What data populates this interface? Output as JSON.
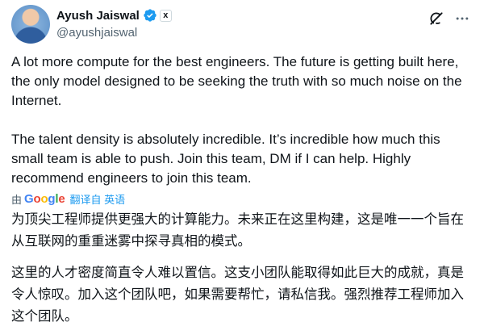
{
  "author": {
    "display_name": "Ayush Jaiswal",
    "handle": "@ayushjaiswal",
    "affiliate_badge": "x"
  },
  "icons": {
    "verified": "verified-badge-icon",
    "grok": "grok-icon",
    "more": "more-options-icon"
  },
  "colors": {
    "verified_blue": "#1d9bf0",
    "text_primary": "#0f1419",
    "text_secondary": "#536471"
  },
  "tweet": {
    "paragraph_1": "A lot more compute for the best engineers. The future is getting built here, the only model designed to be seeking the truth with so much noise on the Internet.",
    "paragraph_2": "The talent density is absolutely incredible. It’s incredible how much this small team is able to push. Join this team, DM if I can help. Highly recommend engineers to join this team."
  },
  "translation": {
    "by_label": "由",
    "provider": "Google",
    "action_label": "翻译自 英语",
    "paragraph_1": "为顶尖工程师提供更强大的计算能力。未来正在这里构建，这是唯一一个旨在从互联网的重重迷雾中探寻真相的模式。",
    "paragraph_2": "这里的人才密度简直令人难以置信。这支小团队能取得如此巨大的成就，真是令人惊叹。加入这个团队吧，如果需要帮忙，请私信我。强烈推荐工程师加入这个团队。"
  }
}
